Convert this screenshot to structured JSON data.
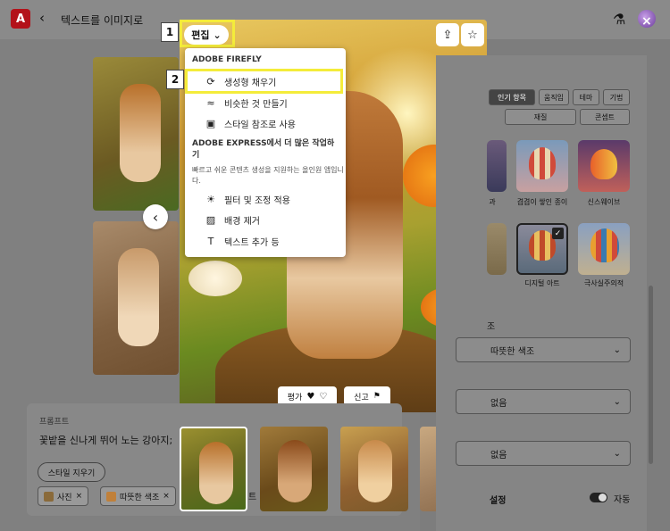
{
  "header": {
    "logo_letter": "A",
    "back_glyph": "‹",
    "title": "텍스트를 이미지로",
    "lab_icon": "flask-icon",
    "close_glyph": "×"
  },
  "edit": {
    "label": "편집",
    "chevron": "⌄"
  },
  "callouts": {
    "one": "1",
    "two": "2"
  },
  "menu": {
    "section1": "ADOBE FIREFLY",
    "items1": [
      {
        "icon": "⟳",
        "label": "생성형 채우기"
      },
      {
        "icon": "≈",
        "label": "비슷한 것 만들기"
      },
      {
        "icon": "▣",
        "label": "스타일 참조로 사용"
      }
    ],
    "section2": "ADOBE EXPRESS에서 더 많은 작업하기",
    "description": "빠르고 쉬운 콘텐츠 생성을 지원하는 올인원 앱입니다.",
    "items2": [
      {
        "icon": "☀",
        "label": "필터 및 조정 적용"
      },
      {
        "icon": "▨",
        "label": "배경 제거"
      },
      {
        "icon": "T",
        "label": "텍스트 추가 등"
      }
    ]
  },
  "rating": {
    "label": "평가",
    "up": "👍",
    "down": "👎"
  },
  "report": {
    "label": "신고",
    "flag": "⚑"
  },
  "nav": {
    "prev": "‹",
    "next": "›"
  },
  "image_actions": {
    "share": "⇪",
    "favorite": "☆"
  },
  "prompt": {
    "label": "프롬프트",
    "text": "꽃밭을 신나게 뛰어 노는 강아지;",
    "clear_styles": "스타일 지우기",
    "chips": [
      {
        "label": "사진",
        "remove": "×"
      },
      {
        "label": "따뜻한 색조",
        "remove": "×"
      }
    ],
    "trailing_fragment": "트"
  },
  "right": {
    "tabs_row1": [
      "인기 항목",
      "움직임",
      "테마",
      "기법"
    ],
    "tabs_row2": [
      "재질",
      "콘셉트"
    ],
    "tiles": [
      {
        "label": "과"
      },
      {
        "label": "겹겹이 쌓인 종이"
      },
      {
        "label": "신스웨이브"
      },
      {
        "label": ""
      },
      {
        "label": "디지털 아트"
      },
      {
        "label": "극사실주의적"
      }
    ],
    "checkmark": "✓",
    "section_fragment": "조",
    "dropdowns": [
      {
        "value": "따뜻한 색조"
      },
      {
        "value": "없음"
      },
      {
        "value": "없음"
      }
    ],
    "chevron": "⌄",
    "settings_label": "설정",
    "auto_label": "자동"
  }
}
